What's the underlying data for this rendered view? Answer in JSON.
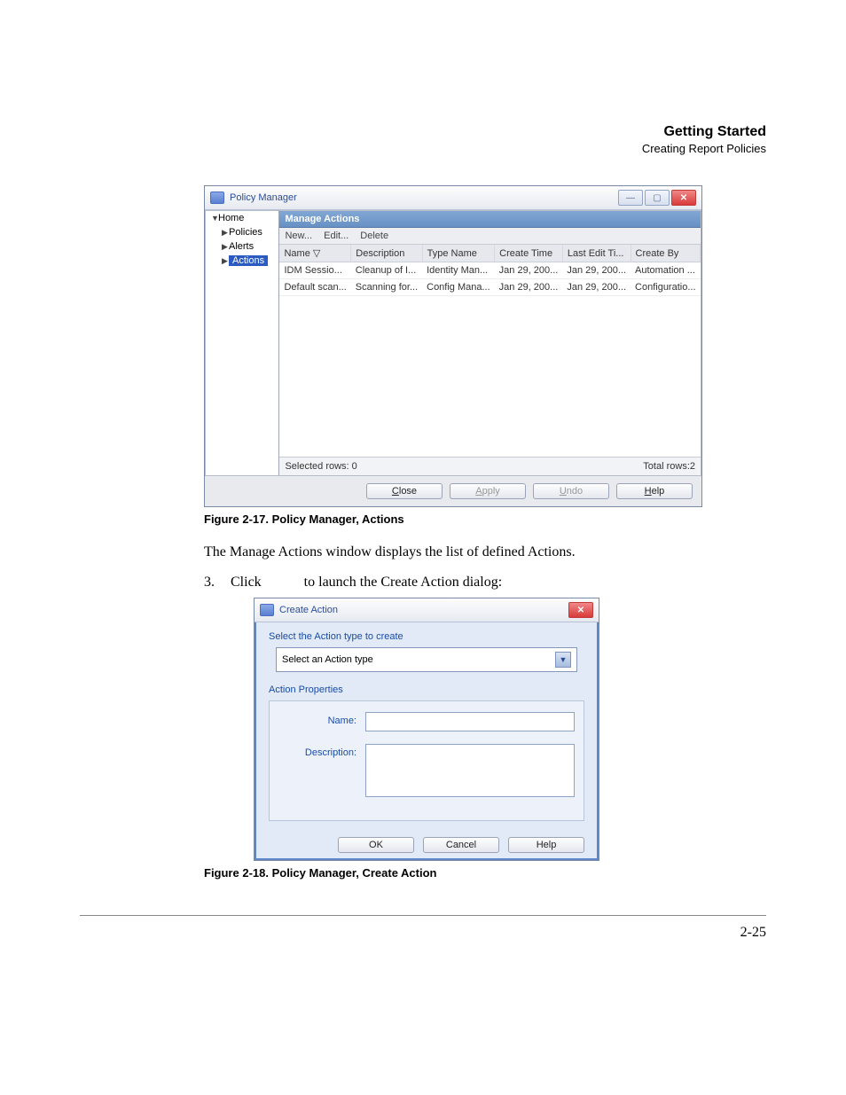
{
  "header": {
    "title": "Getting Started",
    "subtitle": "Creating Report Policies"
  },
  "figure17": {
    "caption": "Figure 2-17. Policy Manager, Actions",
    "window_title": "Policy Manager",
    "tree": {
      "root": "Home",
      "items": [
        "Policies",
        "Alerts",
        "Actions"
      ]
    },
    "panel_title": "Manage Actions",
    "toolbar": {
      "new": "New...",
      "edit": "Edit...",
      "delete": "Delete"
    },
    "columns": [
      "Name ▽",
      "Description",
      "Type Name",
      "Create Time",
      "Last Edit Ti...",
      "Create By"
    ],
    "rows": [
      [
        "IDM Sessio...",
        "Cleanup of I...",
        "Identity Man...",
        "Jan 29, 200...",
        "Jan 29, 200...",
        "Automation ..."
      ],
      [
        "Default scan...",
        "Scanning for...",
        "Config Mana...",
        "Jan 29, 200...",
        "Jan 29, 200...",
        "Configuratio..."
      ]
    ],
    "status": {
      "selected": "Selected rows: 0",
      "total": "Total rows:2"
    },
    "buttons": {
      "close": "Close",
      "apply": "Apply",
      "undo": "Undo",
      "help": "Help"
    }
  },
  "text": {
    "para1": "The Manage Actions window displays the list of defined Actions.",
    "step_num": "3.",
    "step_word": "Click",
    "step_rest": "to launch the Create Action dialog:"
  },
  "figure18": {
    "caption": "Figure 2-18. Policy Manager, Create Action",
    "window_title": "Create Action",
    "section1": "Select the Action type to create",
    "combo_placeholder": "Select an Action type",
    "section2": "Action Properties",
    "name_label": "Name:",
    "desc_label": "Description:",
    "buttons": {
      "ok": "OK",
      "cancel": "Cancel",
      "help": "Help"
    }
  },
  "page_number": "2-25"
}
